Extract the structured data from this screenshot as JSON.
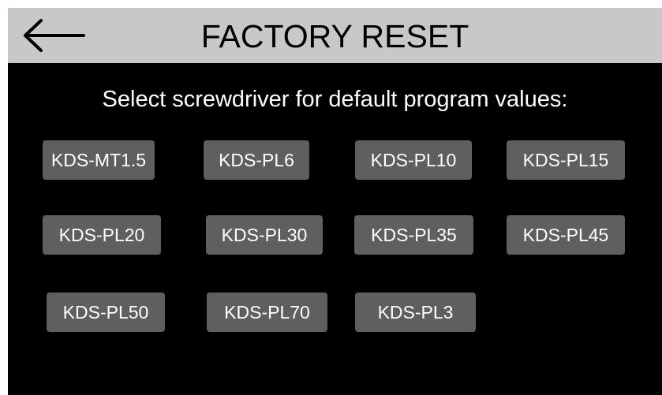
{
  "header": {
    "title": "FACTORY RESET",
    "back_icon": "left-arrow-icon"
  },
  "prompt": "Select screwdriver for default program values:",
  "buttons": [
    {
      "label": "KDS-MT1.5"
    },
    {
      "label": "KDS-PL6"
    },
    {
      "label": "KDS-PL10"
    },
    {
      "label": "KDS-PL15"
    },
    {
      "label": "KDS-PL20"
    },
    {
      "label": "KDS-PL30"
    },
    {
      "label": "KDS-PL35"
    },
    {
      "label": "KDS-PL45"
    },
    {
      "label": "KDS-PL50"
    },
    {
      "label": "KDS-PL70"
    },
    {
      "label": "KDS-PL3"
    }
  ],
  "colors": {
    "header_bg": "#c8c8c8",
    "screen_bg": "#000000",
    "button_bg": "#5f5f5f",
    "button_text": "#ffffff"
  }
}
